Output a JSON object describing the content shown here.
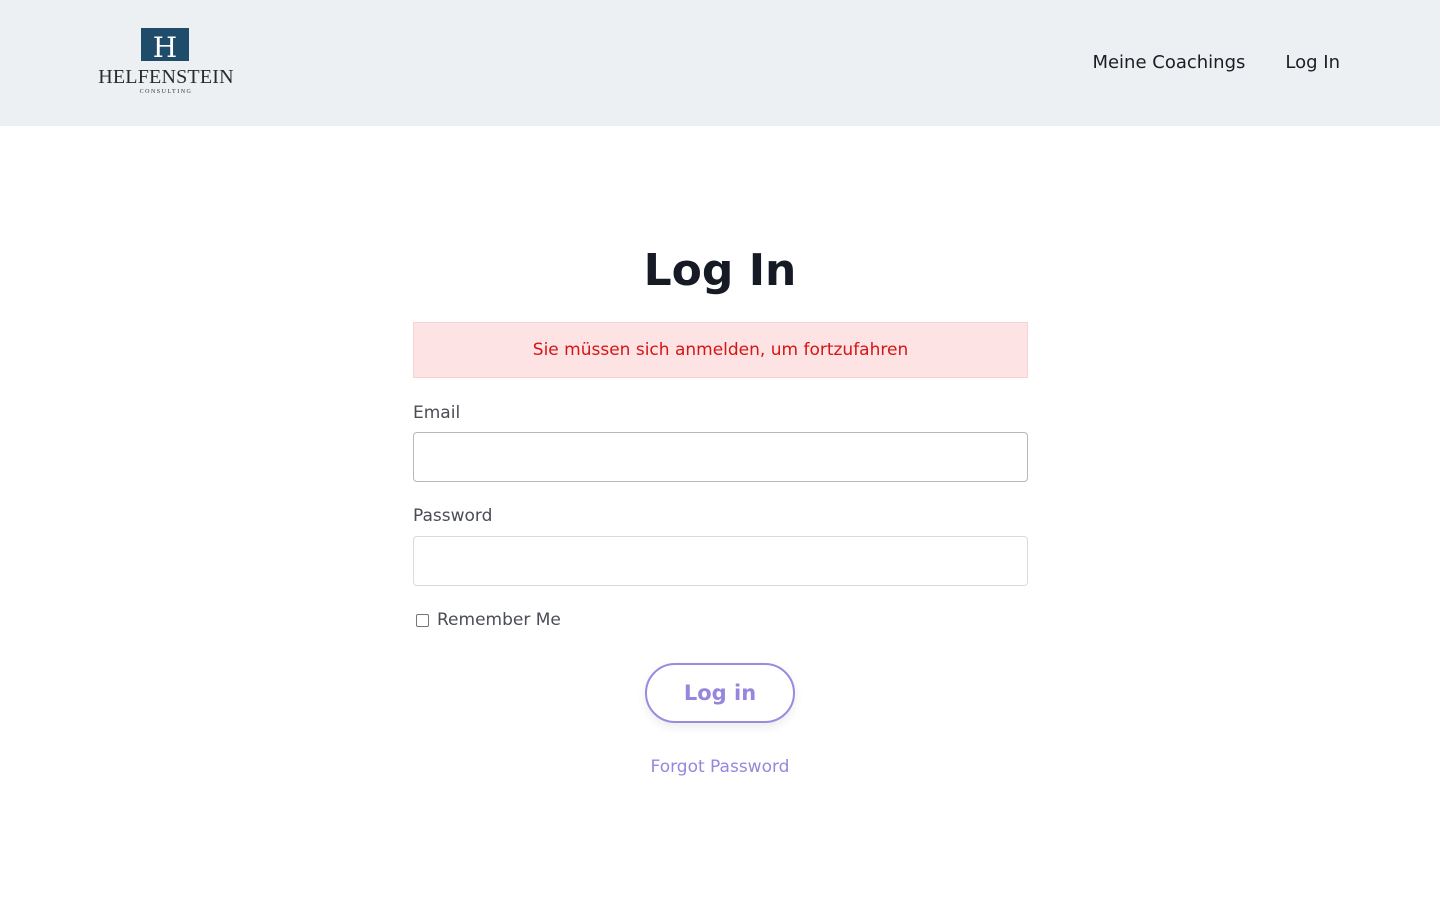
{
  "header": {
    "logo": {
      "mark_letter": "H",
      "name": "HELFENSTEIN",
      "sub": "CONSULTING"
    },
    "nav": [
      {
        "label": "Meine Coachings"
      },
      {
        "label": "Log In"
      }
    ]
  },
  "main": {
    "title": "Log In",
    "alert": "Sie müssen sich anmelden, um fortzufahren",
    "email": {
      "label": "Email",
      "value": "",
      "placeholder": ""
    },
    "password": {
      "label": "Password",
      "value": "",
      "placeholder": ""
    },
    "remember": {
      "label": "Remember Me",
      "checked": false
    },
    "submit_label": "Log in",
    "forgot_label": "Forgot Password"
  },
  "colors": {
    "header_bg": "#ecf0f2",
    "logo_mark": "#1f4c6b",
    "alert_bg": "#fde3e3",
    "alert_text": "#d51515",
    "accent": "#9686dd"
  },
  "icons": {
    "logo": "helfenstein-logo-mark"
  }
}
